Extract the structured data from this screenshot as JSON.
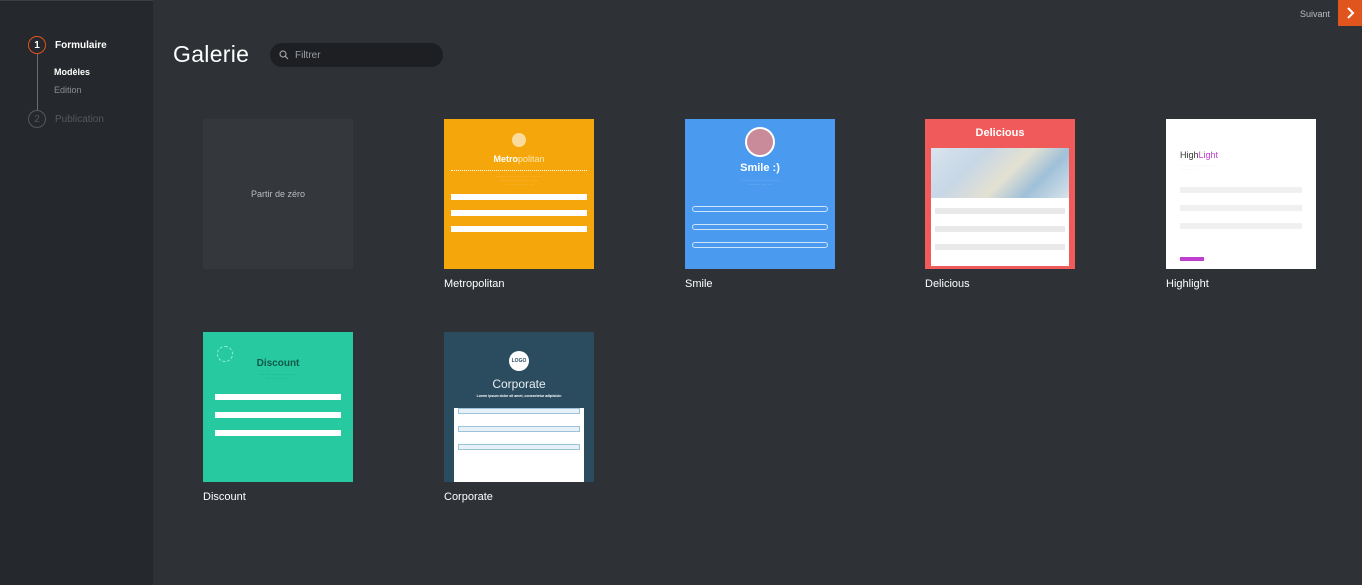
{
  "sidebar": {
    "step1": {
      "number": "1",
      "label": "Formulaire"
    },
    "sub_items": [
      "Modèles",
      "Edition"
    ],
    "step2": {
      "number": "2",
      "label": "Publication"
    }
  },
  "topbar": {
    "next_label": "Suivant"
  },
  "header": {
    "title": "Galerie",
    "search_placeholder": "Filtrer"
  },
  "gallery": {
    "blank_label": "Partir de zéro",
    "templates": [
      {
        "name": "Metropolitan",
        "title_part1": "Metro",
        "title_part2": "politan"
      },
      {
        "name": "Smile",
        "title": "Smile :)"
      },
      {
        "name": "Delicious",
        "title": "Delicious"
      },
      {
        "name": "Highlight",
        "title_part1": "High",
        "title_part2": "Light"
      },
      {
        "name": "Discount",
        "title": "Discount"
      },
      {
        "name": "Corporate",
        "title": "Corporate",
        "subtitle": "Lorem ipsum dolor sit amet, consectetur adipisicin",
        "logo": "LOGO"
      }
    ]
  },
  "colors": {
    "accent": "#e0541e",
    "metropolitan": "#f5a60a",
    "smile": "#4a9bf0",
    "delicious": "#f05a5a",
    "discount": "#26c9a0",
    "corporate": "#2b4c5e",
    "highlight_accent": "#c03ed0"
  }
}
